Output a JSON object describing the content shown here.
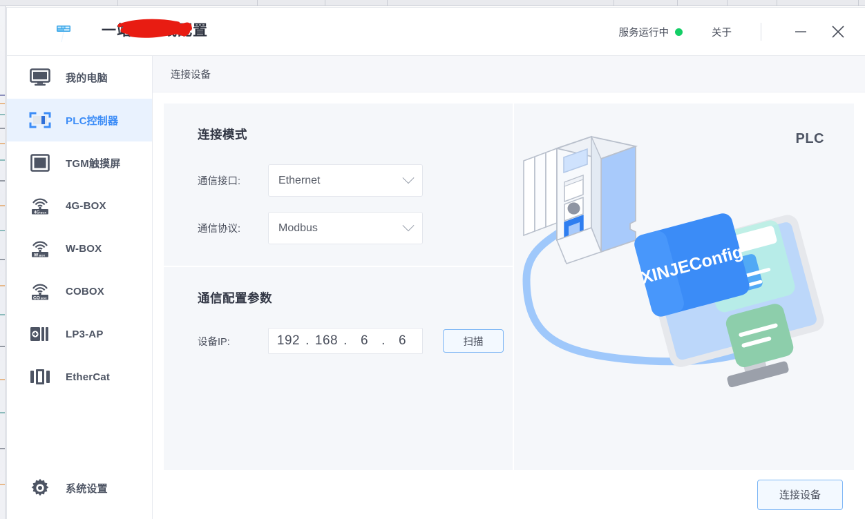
{
  "window": {
    "title": "一站式在线配置",
    "logo_icon": "xinje-logo-icon",
    "service_status": "服务运行中",
    "service_status_color": "#13ce66",
    "about_label": "关于",
    "minimize_icon": "minimize-icon",
    "close_icon": "close-icon"
  },
  "sidebar": {
    "items": [
      {
        "label": "我的电脑",
        "icon": "monitor-icon",
        "active": false
      },
      {
        "label": "PLC控制器",
        "icon": "plc-icon",
        "active": true
      },
      {
        "label": "TGM触摸屏",
        "icon": "touchpanel-icon",
        "active": false
      },
      {
        "label": "4G-BOX",
        "icon": "4g-box-icon",
        "active": false
      },
      {
        "label": "W-BOX",
        "icon": "w-box-icon",
        "active": false
      },
      {
        "label": "COBOX",
        "icon": "co-box-icon",
        "active": false
      },
      {
        "label": "LP3-AP",
        "icon": "lp3-ap-icon",
        "active": false
      },
      {
        "label": "EtherCat",
        "icon": "ethercat-icon",
        "active": false
      }
    ],
    "settings": {
      "label": "系统设置",
      "icon": "gear-icon"
    }
  },
  "breadcrumb": "连接设备",
  "form": {
    "mode_section": {
      "title": "连接模式",
      "fields": [
        {
          "label": "通信接口:",
          "value": "Ethernet",
          "icon": "chevron-down-icon"
        },
        {
          "label": "通信协议:",
          "value": "Modbus",
          "icon": "chevron-down-icon"
        }
      ]
    },
    "params_section": {
      "title": "通信配置参数",
      "ip_label": "设备IP:",
      "ip": {
        "octet1": "192",
        "octet2": "168",
        "octet3": "6",
        "octet4": "6",
        "separator": "."
      },
      "scan_label": "扫描"
    }
  },
  "illustration": {
    "device_label": "PLC",
    "screen_text": "XINJEConfig"
  },
  "footer": {
    "connect_label": "连接设备"
  },
  "colors": {
    "accent": "#3b8cf7",
    "active_nav_bg": "#e9f2fe",
    "panel_bg": "#f5f7fa",
    "status_green": "#13ce66",
    "redaction_red": "#e81c12"
  }
}
